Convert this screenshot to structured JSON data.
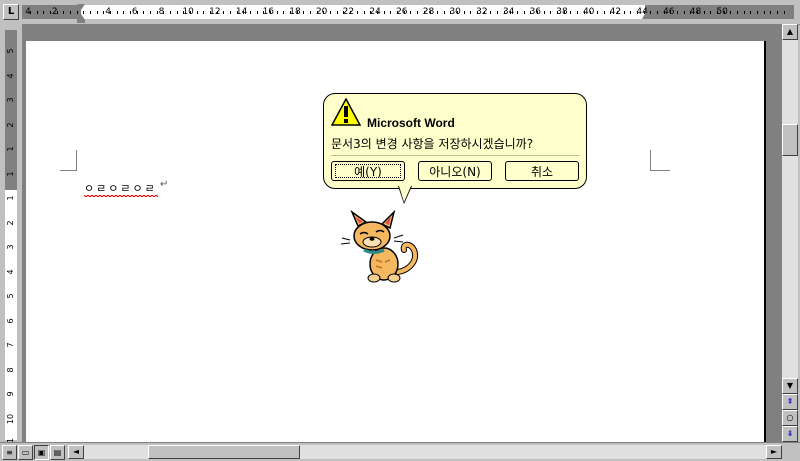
{
  "ruler": {
    "corner_label": "L",
    "top_numbers": [
      "4",
      "2",
      "2",
      "4",
      "6",
      "8",
      "10",
      "12",
      "14",
      "16",
      "18",
      "20",
      "22",
      "24",
      "26",
      "28",
      "30",
      "32",
      "34",
      "36",
      "38",
      "40",
      "42",
      "44",
      "46",
      "48",
      "50"
    ],
    "left_numbers": [
      "5",
      "4",
      "3",
      "2",
      "1",
      "1",
      "1",
      "2",
      "3",
      "4",
      "5",
      "6",
      "7",
      "8",
      "9",
      "10",
      "11"
    ]
  },
  "document": {
    "text": "ㅇㄹㅇㄹㅇㄹ",
    "para_mark": "↵"
  },
  "balloon": {
    "title": "Microsoft Word",
    "message": "문서3의 변경 사항을 저장하시겠습니까?",
    "buttons": {
      "yes": "예(Y)",
      "no": "아니오(N)",
      "cancel": "취소"
    },
    "icon": "warning-icon"
  },
  "assistant": {
    "icon": "office-cat-assistant"
  },
  "scrollbar": {
    "up": "▲",
    "down": "▼",
    "prev_page": "⇞",
    "browse": "○",
    "next_page": "⇟",
    "left": "◄",
    "right": "►"
  },
  "view_buttons": [
    "≡",
    "▭",
    "▣",
    "▤"
  ],
  "colors": {
    "balloon_bg": "#ffffcc",
    "chrome": "#c0c0c0",
    "squiggle": "#ff0000"
  }
}
